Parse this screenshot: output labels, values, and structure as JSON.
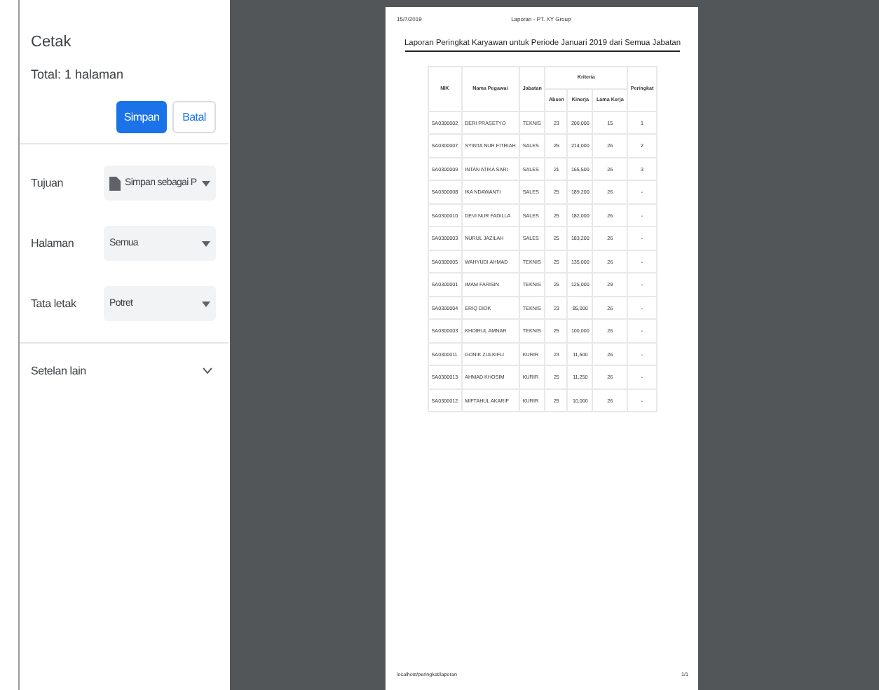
{
  "sidebar": {
    "title": "Cetak",
    "total": "Total: 1 halaman",
    "buttons": [
      {
        "label": "Simpan",
        "kind": "primary"
      },
      {
        "label": "Batal",
        "kind": "secondary"
      }
    ],
    "settings": [
      {
        "label": "Tujuan",
        "value": "Simpan sebagai P",
        "kind": "file"
      },
      {
        "label": "Halaman",
        "value": "Semua",
        "kind": "plain"
      },
      {
        "label": "Tata letak",
        "value": "Potret",
        "kind": "plain"
      }
    ],
    "more": {
      "label": "Setelan lain",
      "expanded": false
    }
  },
  "page": {
    "date": "15/7/2019",
    "header_title": "Laporan - PT. XY Group",
    "report_title": "Laporan Peringkat Karyawan untuk Periode Januari 2019 dari Semua Jabatan",
    "table": {
      "columns": [
        "NIK",
        "Nama Pegawai",
        "Jabatan"
      ],
      "group": "Kriteria",
      "criteria": [
        "Absen",
        "Kinerja",
        "Lama Kerja"
      ],
      "last": "Peringkat",
      "rows": [
        [
          "SA0300002",
          "DERI PRASETYO",
          "TEKNIS",
          "23",
          "200,000",
          "15",
          "1"
        ],
        [
          "SA0300007",
          "SYINTA NUR FITRIAH",
          "SALES",
          "25",
          "214,000",
          "26",
          "2"
        ],
        [
          "SA0300009",
          "INTAN ATIKA SARI",
          "SALES",
          "21",
          "165,500",
          "26",
          "3"
        ],
        [
          "SA0300008",
          "IKA NDAWANTI",
          "SALES",
          "25",
          "189,200",
          "26",
          "-"
        ],
        [
          "SA0300010",
          "DEVI NUR FADILLA",
          "SALES",
          "25",
          "182,000",
          "26",
          "-"
        ],
        [
          "SA0300003",
          "NURUL JAZILAH",
          "SALES",
          "25",
          "183,200",
          "26",
          "-"
        ],
        [
          "SA0300005",
          "WAHYUDI AHMAD",
          "TEKNIS",
          "25",
          "135,000",
          "26",
          "-"
        ],
        [
          "SA0300001",
          "IMAM FARISIN",
          "TEKNIS",
          "25",
          "125,000",
          "29",
          "-"
        ],
        [
          "SA0300004",
          "ERIQ DIOK",
          "TEKNIS",
          "23",
          "85,000",
          "26",
          "-"
        ],
        [
          "SA0300003",
          "KHOIRUL AMNAR",
          "TEKNIS",
          "25",
          "100,000",
          "26",
          "-"
        ],
        [
          "SA0300011",
          "GONIK ZULKIFLI",
          "KURIR",
          "23",
          "11,500",
          "26",
          "-"
        ],
        [
          "SA0300013",
          "AHMAD KHOSIM",
          "KURIR",
          "25",
          "11,250",
          "26",
          "-"
        ],
        [
          "SA0300012",
          "MIFTAHUL AKARIF",
          "KURIR",
          "25",
          "10,000",
          "26",
          "-"
        ]
      ]
    },
    "footer_url": "localhost/peringkat/laporan",
    "footer_page": "1/1"
  }
}
